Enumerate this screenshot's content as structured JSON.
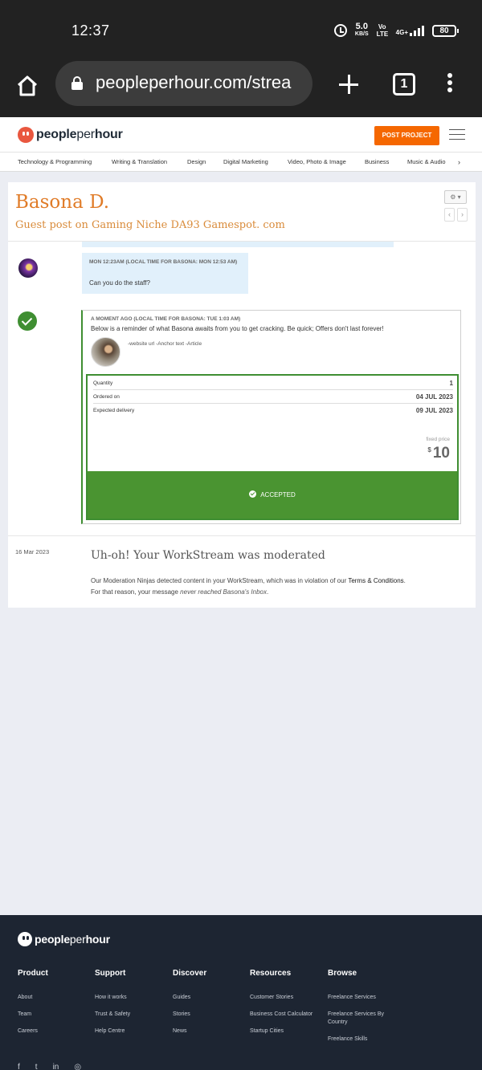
{
  "statusbar": {
    "time": "12:37",
    "speed": "5.0",
    "speed_unit": "KB/S",
    "volte": "Vo LTE",
    "network": "4G+",
    "battery": "80"
  },
  "browser": {
    "url": "peopleperhour.com/strea",
    "tab_count": "1"
  },
  "header": {
    "logo_bold": "people",
    "logo_light": "per",
    "logo_bold2": "hour",
    "post_project": "POST PROJECT"
  },
  "categories": [
    "Technology & Programming",
    "Writing & Translation",
    "Design",
    "Digital Marketing",
    "Video, Photo & Image",
    "Business",
    "Music & Audio"
  ],
  "stream": {
    "name": "Basona D.",
    "subtitle": "Guest post on Gaming Niche DA93 Gamespot. com",
    "gear_label": "⚙ ▾",
    "message": {
      "meta": "MON 12:23AM (LOCAL TIME FOR BASONA: MON 12:53 AM)",
      "text": "Can you do the staff?"
    },
    "offer": {
      "meta": "A MOMENT AGO (LOCAL TIME FOR BASONA: TUE 1:03 AM)",
      "text": "Below is a reminder of what Basona awaits from you to get cracking. Be quick; Offers don't last forever!",
      "description": "-website url -Anchor text -Article",
      "rows": [
        {
          "label": "Quantity",
          "value": "1"
        },
        {
          "label": "Ordered on",
          "value": "04 JUL 2023"
        },
        {
          "label": "Expected delivery",
          "value": "09 JUL 2023"
        }
      ],
      "price_label": "fixed price",
      "currency": "$",
      "price": "10",
      "status": "ACCEPTED"
    },
    "moderation": {
      "date": "16 Mar 2023",
      "title": "Uh-oh! Your WorkStream was moderated",
      "text1": "Our Moderation Ninjas detected content in your WorkStream, which was in violation of our ",
      "link": "Terms & Conditions",
      "text2": ".",
      "text3": "For that reason, your message ",
      "emph": "never reached Basona's Inbox",
      "text4": "."
    }
  },
  "footer": {
    "columns": [
      {
        "title": "Product",
        "links": [
          "About",
          "Team",
          "Careers"
        ]
      },
      {
        "title": "Support",
        "links": [
          "How it works",
          "Trust & Safety",
          "Help Centre"
        ]
      },
      {
        "title": "Discover",
        "links": [
          "Guides",
          "Stories",
          "News"
        ]
      },
      {
        "title": "Resources",
        "links": [
          "Customer Stories",
          "Business Cost Calculator",
          "Startup Cities"
        ]
      },
      {
        "title": "Browse",
        "links": [
          "Freelance Services",
          "Freelance Services By Country",
          "Freelance Skills"
        ]
      }
    ],
    "social": [
      "facebook-icon",
      "twitter-icon",
      "linkedin-icon",
      "instagram-icon"
    ]
  }
}
